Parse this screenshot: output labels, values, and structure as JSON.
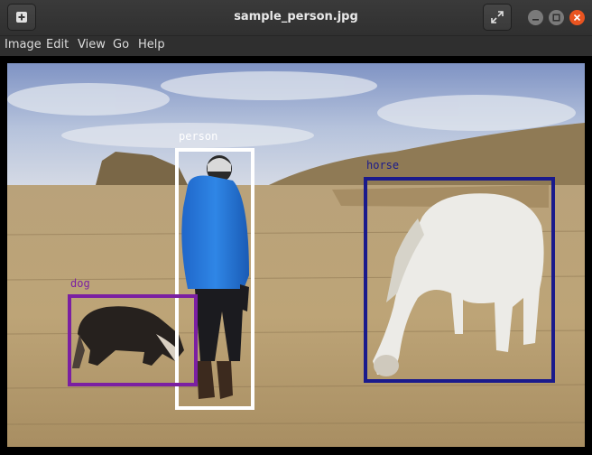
{
  "window": {
    "title": "sample_person.jpg",
    "icons": {
      "new": "new-image-icon",
      "fullscreen": "fullscreen-icon",
      "minimize": "minimize-icon",
      "maximize": "maximize-icon",
      "close": "close-icon"
    },
    "colors": {
      "close": "#e95420",
      "titlebar": "#333333"
    }
  },
  "menu": {
    "items": [
      {
        "label": "Image"
      },
      {
        "label": "Edit"
      },
      {
        "label": "View"
      },
      {
        "label": "Go"
      },
      {
        "label": "Help"
      }
    ]
  },
  "image": {
    "detections": [
      {
        "label": "person",
        "color": "#ffffff"
      },
      {
        "label": "horse",
        "color": "#1a1a8c"
      },
      {
        "label": "dog",
        "color": "#7b1fa2"
      }
    ]
  }
}
